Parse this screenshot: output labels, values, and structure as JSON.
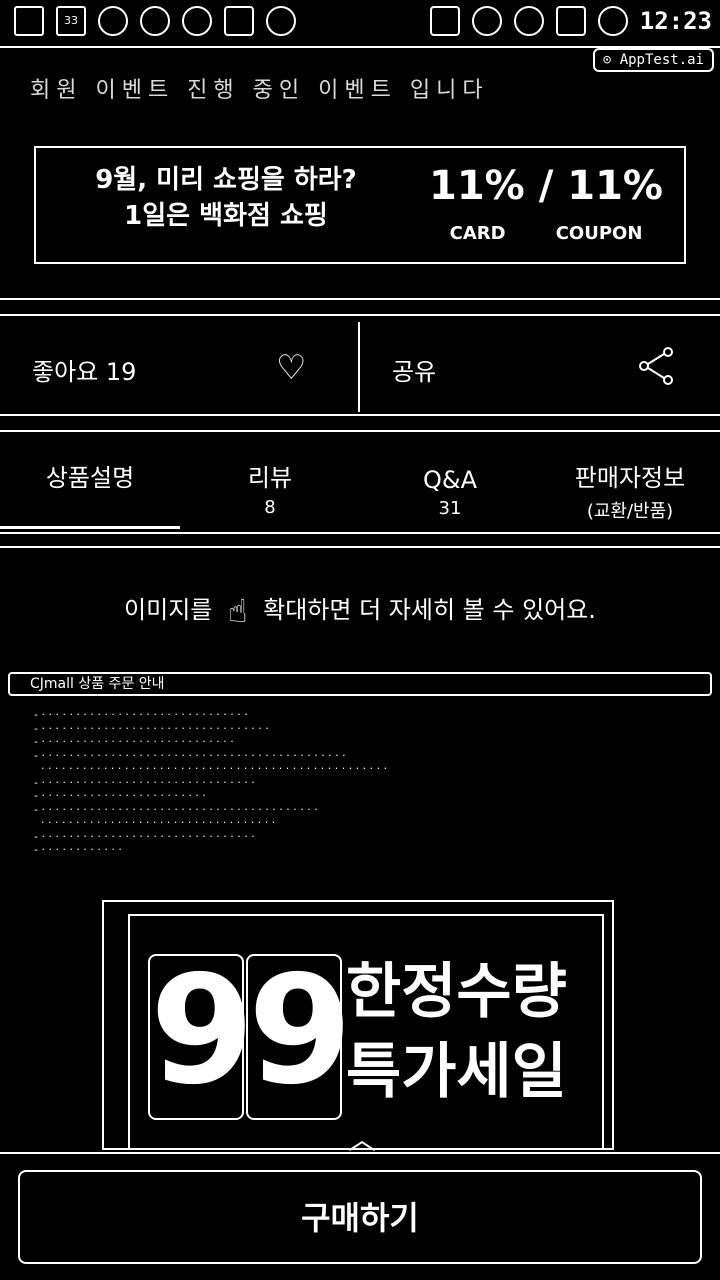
{
  "status_bar": {
    "time": "12:23",
    "left_icons": [
      "glasses-icon",
      "calendar-icon",
      "person-icon",
      "refresh-icon",
      "clock-icon",
      "play-icon",
      "circle-icon"
    ],
    "right_icons": [
      "cast-icon",
      "minus-icon",
      "wifi-icon",
      "signal-icon",
      "location-icon"
    ],
    "calendar_day": "33"
  },
  "apptest_badge": "AppTest.ai",
  "top_cut_text": "회원 이벤트 진행 중인 이벤트 입니다",
  "promo_banner": {
    "line1": "9월, 미리 쇼핑을 하라?",
    "line2": "1일은 백화점 쇼핑",
    "card_value": "11%",
    "card_label": "CARD",
    "separator": "/",
    "coupon_value": "11%",
    "coupon_label": "COUPON"
  },
  "actions": {
    "like_label": "좋아요",
    "like_count": "19",
    "share_label": "공유"
  },
  "tabs": [
    {
      "label": "상품설명",
      "sub": ""
    },
    {
      "label": "리뷰",
      "sub": "8"
    },
    {
      "label": "Q&A",
      "sub": "31"
    },
    {
      "label": "판매자정보",
      "sub": "(교환/반품)"
    }
  ],
  "zoom_hint": {
    "before": "이미지를",
    "after": "확대하면 더 자세히 볼 수 있어요."
  },
  "cjmall_bar": "CJmall 상품 주문 안내",
  "deal": {
    "digit1": "9",
    "digit2": "9",
    "word1": "한정수량",
    "word2": "특가세일"
  },
  "buy_button": "구매하기"
}
